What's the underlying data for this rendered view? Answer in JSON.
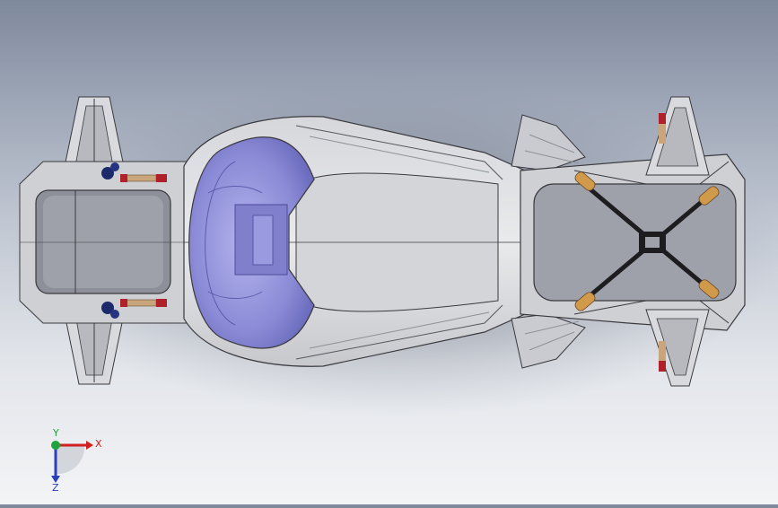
{
  "viewport": {
    "description_icon": "cad-3d-model",
    "colors": {
      "background_top": "#7f899c",
      "background_bottom": "#f3f4f6",
      "body_light": "#e4e5e8",
      "body_mid": "#c9cbd0",
      "body_dark": "#8e9096",
      "canopy": "#8f8fd8",
      "spring": "#c9a57c",
      "damper_blue": "#1c2a6b",
      "damper_red": "#b0202a",
      "orange_joint": "#d09a4a"
    }
  },
  "triad": {
    "x_label": "X",
    "y_label": "Y",
    "z_label": "Z",
    "x_color": "#d02020",
    "y_color": "#1fa33a",
    "z_color": "#2a3fb8"
  }
}
